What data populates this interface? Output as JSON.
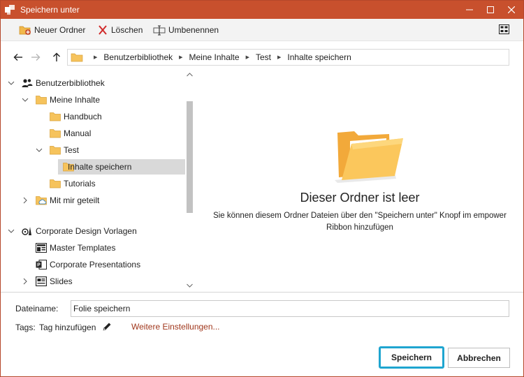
{
  "window": {
    "title": "Speichern unter",
    "accent": "#c8502d"
  },
  "toolbar": {
    "new_folder": "Neuer Ordner",
    "delete": "Löschen",
    "rename": "Umbenennen"
  },
  "icons": {
    "app": "app-icon",
    "minimize": "minimize-icon",
    "maximize": "maximize-icon",
    "close": "close-icon",
    "back": "arrow-left-icon",
    "forward": "arrow-right-icon",
    "up": "arrow-up-icon",
    "view": "grid-view-icon"
  },
  "breadcrumb": [
    "Benutzerbibliothek",
    "Meine Inhalte",
    "Test",
    "Inhalte speichern"
  ],
  "tree": {
    "user_library": "Benutzerbibliothek",
    "my_content": "Meine Inhalte",
    "handbuch": "Handbuch",
    "manual": "Manual",
    "test": "Test",
    "save_content": "Inhalte speichern",
    "tutorials": "Tutorials",
    "shared": "Mit mir geteilt",
    "corporate": "Corporate Design Vorlagen",
    "master": "Master Templates",
    "presentations": "Corporate Presentations",
    "slides": "Slides"
  },
  "empty": {
    "title": "Dieser Ordner ist leer",
    "description": "Sie können diesem Ordner Dateien über den \"Speichern unter\" Knopf im empower Ribbon hinzufügen"
  },
  "form": {
    "filename_label": "Dateiname:",
    "filename_value": "Folie speichern",
    "tags_label": "Tags:",
    "tag_add": "Tag hinzufügen",
    "more_settings": "Weitere Einstellungen..."
  },
  "buttons": {
    "save": "Speichern",
    "cancel": "Abbrechen"
  },
  "colors": {
    "link": "#a0371c",
    "focus": "#1fa5d0",
    "folder": "#f6c35c"
  }
}
